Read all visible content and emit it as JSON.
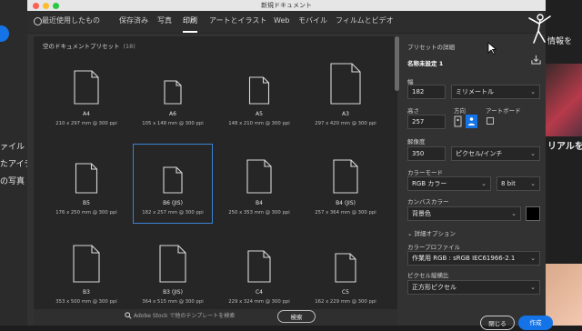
{
  "window_title": "新規ドキュメント",
  "tabs": [
    {
      "label": "最近使用したもの",
      "active": false
    },
    {
      "label": "保存済み",
      "active": false
    },
    {
      "label": "写真",
      "active": false
    },
    {
      "label": "印刷",
      "active": true
    },
    {
      "label": "アートとイラスト",
      "active": false
    },
    {
      "label": "Web",
      "active": false
    },
    {
      "label": "モバイル",
      "active": false
    },
    {
      "label": "フィルムとビデオ",
      "active": false
    }
  ],
  "presets_header": "空のドキュメントプリセット",
  "presets_count": "(18)",
  "presets": [
    {
      "name": "A4",
      "size": "210 x 297 mm @ 300 ppi",
      "orientation": "portrait",
      "selected": false
    },
    {
      "name": "A6",
      "size": "105 x 148 mm @ 300 ppi",
      "orientation": "portrait",
      "selected": false
    },
    {
      "name": "A5",
      "size": "148 x 210 mm @ 300 ppi",
      "orientation": "portrait",
      "selected": false
    },
    {
      "name": "A3",
      "size": "297 x 420 mm @ 300 ppi",
      "orientation": "portrait",
      "selected": false
    },
    {
      "name": "B5",
      "size": "176 x 250 mm @ 300 ppi",
      "orientation": "portrait",
      "selected": false
    },
    {
      "name": "B6 (JIS)",
      "size": "182 x 257 mm @ 300 ppi",
      "orientation": "portrait",
      "selected": true
    },
    {
      "name": "B4",
      "size": "250 x 353 mm @ 300 ppi",
      "orientation": "portrait",
      "selected": false
    },
    {
      "name": "B4 (JIS)",
      "size": "257 x 364 mm @ 300 ppi",
      "orientation": "portrait",
      "selected": false
    },
    {
      "name": "B3",
      "size": "353 x 500 mm @ 300 ppi",
      "orientation": "portrait",
      "selected": false
    },
    {
      "name": "B3 (JIS)",
      "size": "364 x 515 mm @ 300 ppi",
      "orientation": "portrait",
      "selected": false
    },
    {
      "name": "C4",
      "size": "229 x 324 mm @ 300 ppi",
      "orientation": "portrait",
      "selected": false
    },
    {
      "name": "C5",
      "size": "162 x 229 mm @ 300 ppi",
      "orientation": "portrait",
      "selected": false
    }
  ],
  "stock": {
    "text": "Adobe Stock で他のテンプレートを検索",
    "button": "検索"
  },
  "details": {
    "header": "プリセットの詳細",
    "preset_name": "名称未設定 1",
    "width_label": "幅",
    "width_value": "182",
    "width_unit": "ミリメートル",
    "height_label": "高さ",
    "height_value": "257",
    "orientation_label": "方向",
    "artboard_label": "アートボード",
    "resolution_label": "解像度",
    "resolution_value": "350",
    "resolution_unit": "ピクセル/インチ",
    "color_mode_label": "カラーモード",
    "color_mode_value": "RGB カラー",
    "bit_depth": "8 bit",
    "canvas_color_label": "カンバスカラー",
    "canvas_color_value": "背景色",
    "advanced_label": "詳細オプション",
    "color_profile_label": "カラープロファイル",
    "color_profile_value": "作業用 RGB : sRGB IEC61966-2.1",
    "pixel_aspect_label": "ピクセル縦横比",
    "pixel_aspect_value": "正方形ピクセル",
    "close_button": "閉じる",
    "create_button": "作成"
  },
  "background_left": [
    "ァイル",
    "たアイテム",
    "の写真"
  ],
  "background_right": [
    "情報を",
    "リアルを"
  ],
  "colors": {
    "accent": "#1473e6",
    "selected_border": "#3b82d6",
    "dialog_bg": "#323232",
    "grid_bg": "#262626"
  }
}
